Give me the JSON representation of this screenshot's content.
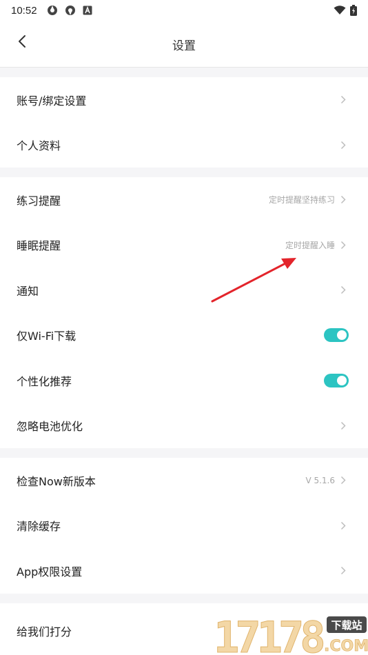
{
  "status_bar": {
    "time": "10:52"
  },
  "header": {
    "title": "设置"
  },
  "groups": [
    {
      "rows": [
        {
          "label": "账号/绑定设置"
        },
        {
          "label": "个人资料"
        }
      ]
    },
    {
      "rows": [
        {
          "label": "练习提醒",
          "value": "定时提醒坚持练习"
        },
        {
          "label": "睡眠提醒",
          "value": "定时提醒入睡"
        },
        {
          "label": "通知"
        },
        {
          "label": "仅Wi-Fi下载",
          "toggle": true
        },
        {
          "label": "个性化推荐",
          "toggle": true
        },
        {
          "label": "忽略电池优化"
        }
      ]
    },
    {
      "rows": [
        {
          "label": "检查Now新版本",
          "value": "V 5.1.6"
        },
        {
          "label": "清除缓存"
        },
        {
          "label": "App权限设置"
        }
      ]
    },
    {
      "rows": [
        {
          "label": "给我们打分"
        }
      ]
    }
  ],
  "watermark": {
    "digits": "17178",
    "badge": "下载站",
    "domain": ".COM"
  },
  "colors": {
    "toggle_on": "#2cc4c2",
    "annotation_arrow": "#e3242b"
  }
}
